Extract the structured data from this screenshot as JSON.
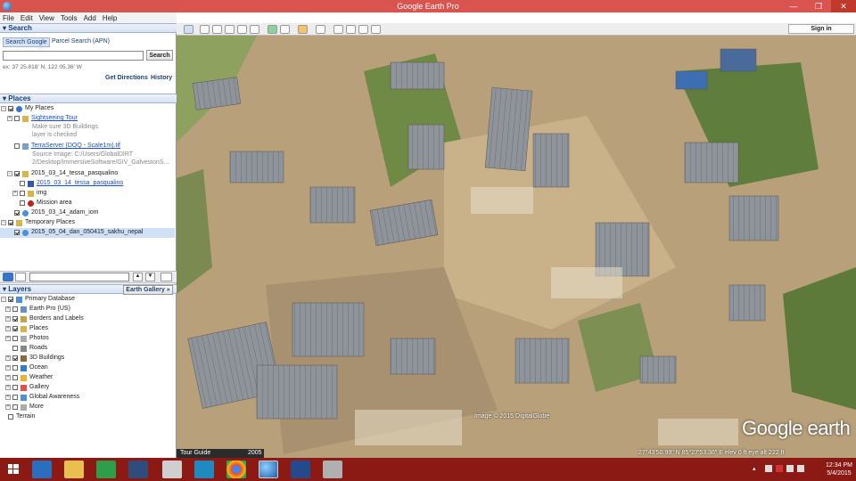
{
  "window": {
    "title": "Google Earth Pro",
    "minimize": "—",
    "maximize": "❐",
    "close": "✕"
  },
  "menu": [
    "File",
    "Edit",
    "View",
    "Tools",
    "Add",
    "Help"
  ],
  "toolbar": {
    "signin": "Sign in"
  },
  "search": {
    "header": "▾ Search",
    "tabs": [
      "Search Google",
      "Parcel Search (APN)"
    ],
    "input_value": "",
    "button": "Search",
    "example": "ex: 37 25.818' N, 122 05.36' W",
    "get_directions": "Get Directions",
    "history": "History"
  },
  "places": {
    "header": "▾ Places",
    "items": [
      {
        "label": "My Places",
        "checked": true,
        "expand": "−",
        "icon": "my-places"
      },
      {
        "label": "Sightseeing Tour",
        "checked": false,
        "expand": "+",
        "icon": "folder",
        "link": true
      },
      {
        "label": "Make sure 3D Buildings",
        "gray": true
      },
      {
        "label": "layer is checked",
        "gray": true
      },
      {
        "label": "TerraServer (DOQ - Scale1m).tif",
        "checked": false,
        "icon": "image",
        "link": true
      },
      {
        "label": "Source Image: C:/Users/GlobalDIRT",
        "gray": true
      },
      {
        "label": "2/Desktop/ImmersiveSoftware/GIV_GalvestonS...",
        "gray": true
      },
      {
        "label": "2015_03_14_tessa_pasqualino",
        "checked": true,
        "expand": "−",
        "icon": "folder"
      },
      {
        "label": "2015_03_14_tessa_pasqualino",
        "checked": false,
        "icon": "path",
        "link": true
      },
      {
        "label": "img",
        "checked": false,
        "expand": "+",
        "icon": "folder"
      },
      {
        "label": "Mission area",
        "checked": false,
        "icon": "polygon"
      },
      {
        "label": "2015_03_14_adam_iom",
        "checked": true,
        "icon": "globe"
      },
      {
        "label": "Temporary Places",
        "checked": true,
        "expand": "−",
        "icon": "folder"
      },
      {
        "label": "2015_05_04_dan_050415_sakhu_nepal",
        "checked": true,
        "icon": "globe",
        "selected": true
      }
    ]
  },
  "layers": {
    "header": "▾ Layers",
    "earth_gallery": "Earth Gallery »",
    "items": [
      {
        "label": "Primary Database",
        "checked": true,
        "expand": "−"
      },
      {
        "label": "Earth Pro (US)",
        "checked": false,
        "expand": "+"
      },
      {
        "label": "Borders and Labels",
        "checked": true,
        "expand": "+"
      },
      {
        "label": "Places",
        "checked": true,
        "expand": "+"
      },
      {
        "label": "Photos",
        "checked": false,
        "expand": "+"
      },
      {
        "label": "Roads",
        "checked": false
      },
      {
        "label": "3D Buildings",
        "checked": true,
        "expand": "+"
      },
      {
        "label": "Ocean",
        "checked": false,
        "expand": "+"
      },
      {
        "label": "Weather",
        "checked": false,
        "expand": "+"
      },
      {
        "label": "Gallery",
        "checked": false,
        "expand": "+"
      },
      {
        "label": "Global Awareness",
        "checked": false,
        "expand": "+"
      },
      {
        "label": "More",
        "checked": false,
        "expand": "+"
      },
      {
        "label": "Terrain",
        "checked": false
      }
    ]
  },
  "map": {
    "tour_guide": "Tour Guide",
    "year": "2005",
    "image_copyright": "Image © 2015 DigitalGlobe",
    "logo": "Google earth",
    "status": "27°43'50.99\" N   85°27'53.36\" E  elev   0 ft      eye alt  222 ft"
  },
  "taskbar": {
    "time": "12:34 PM",
    "date": "5/4/2015"
  },
  "colors": {
    "titlebar": "#d9534f",
    "taskbar": "#8b1a14",
    "selection": "#cfe0f7"
  }
}
